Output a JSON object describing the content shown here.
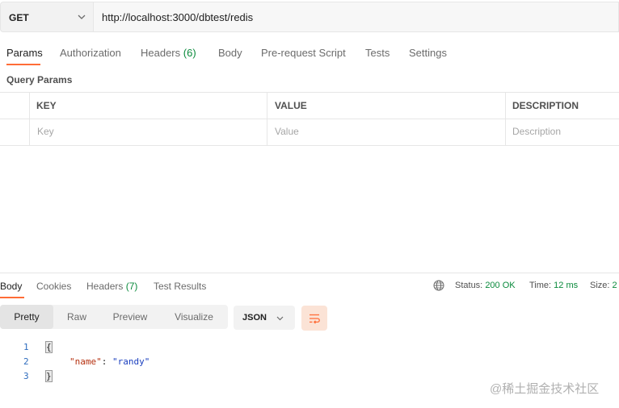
{
  "request": {
    "method": "GET",
    "url": "http://localhost:3000/dbtest/redis"
  },
  "request_tabs": [
    {
      "label": "Params",
      "count": "",
      "active": true
    },
    {
      "label": "Authorization",
      "count": ""
    },
    {
      "label": "Headers",
      "count": "(6)"
    },
    {
      "label": "Body",
      "count": ""
    },
    {
      "label": "Pre-request Script",
      "count": ""
    },
    {
      "label": "Tests",
      "count": ""
    },
    {
      "label": "Settings",
      "count": ""
    }
  ],
  "query_params": {
    "title": "Query Params",
    "columns": [
      "KEY",
      "VALUE",
      "DESCRIPTION"
    ],
    "placeholders": [
      "Key",
      "Value",
      "Description"
    ]
  },
  "response_tabs": [
    {
      "label": "Body",
      "count": "",
      "active": true
    },
    {
      "label": "Cookies",
      "count": ""
    },
    {
      "label": "Headers",
      "count": "(7)"
    },
    {
      "label": "Test Results",
      "count": ""
    }
  ],
  "status": {
    "status_label": "Status:",
    "status_value": "200 OK",
    "time_label": "Time:",
    "time_value": "12 ms",
    "size_label": "Size:",
    "size_value": "2"
  },
  "view_modes": [
    "Pretty",
    "Raw",
    "Preview",
    "Visualize"
  ],
  "format": "JSON",
  "code": {
    "line_numbers": [
      "1",
      "2",
      "3"
    ],
    "open_brace": "{",
    "key": "\"name\"",
    "colon": ": ",
    "value": "\"randy\"",
    "close_brace": "}"
  },
  "watermark": "@稀土掘金技术社区",
  "colors": {
    "accent": "#ff6c37",
    "ok_green": "#0a8a3c"
  }
}
